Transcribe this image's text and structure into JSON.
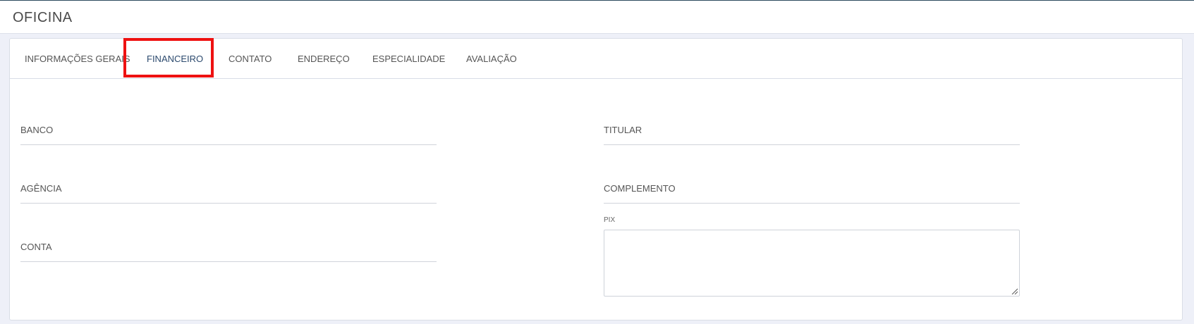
{
  "header": {
    "title": "OFICINA"
  },
  "tabs": [
    {
      "label": "INFORMAÇÕES GERAIS"
    },
    {
      "label": "FINANCEIRO"
    },
    {
      "label": "CONTATO"
    },
    {
      "label": "ENDEREÇO"
    },
    {
      "label": "ESPECIALIDADE"
    },
    {
      "label": "AVALIAÇÃO"
    }
  ],
  "active_tab": "FINANCEIRO",
  "form": {
    "banco": {
      "label": "BANCO",
      "value": ""
    },
    "agencia": {
      "label": "AGÊNCIA",
      "value": ""
    },
    "conta": {
      "label": "CONTA",
      "value": ""
    },
    "titular": {
      "label": "TITULAR",
      "value": ""
    },
    "complemento": {
      "label": "COMPLEMENTO",
      "value": ""
    },
    "pix": {
      "label": "PIX",
      "value": ""
    }
  },
  "colors": {
    "accent": "#2c4a6e",
    "highlight": "#ee1111",
    "background": "#eef0f8"
  }
}
